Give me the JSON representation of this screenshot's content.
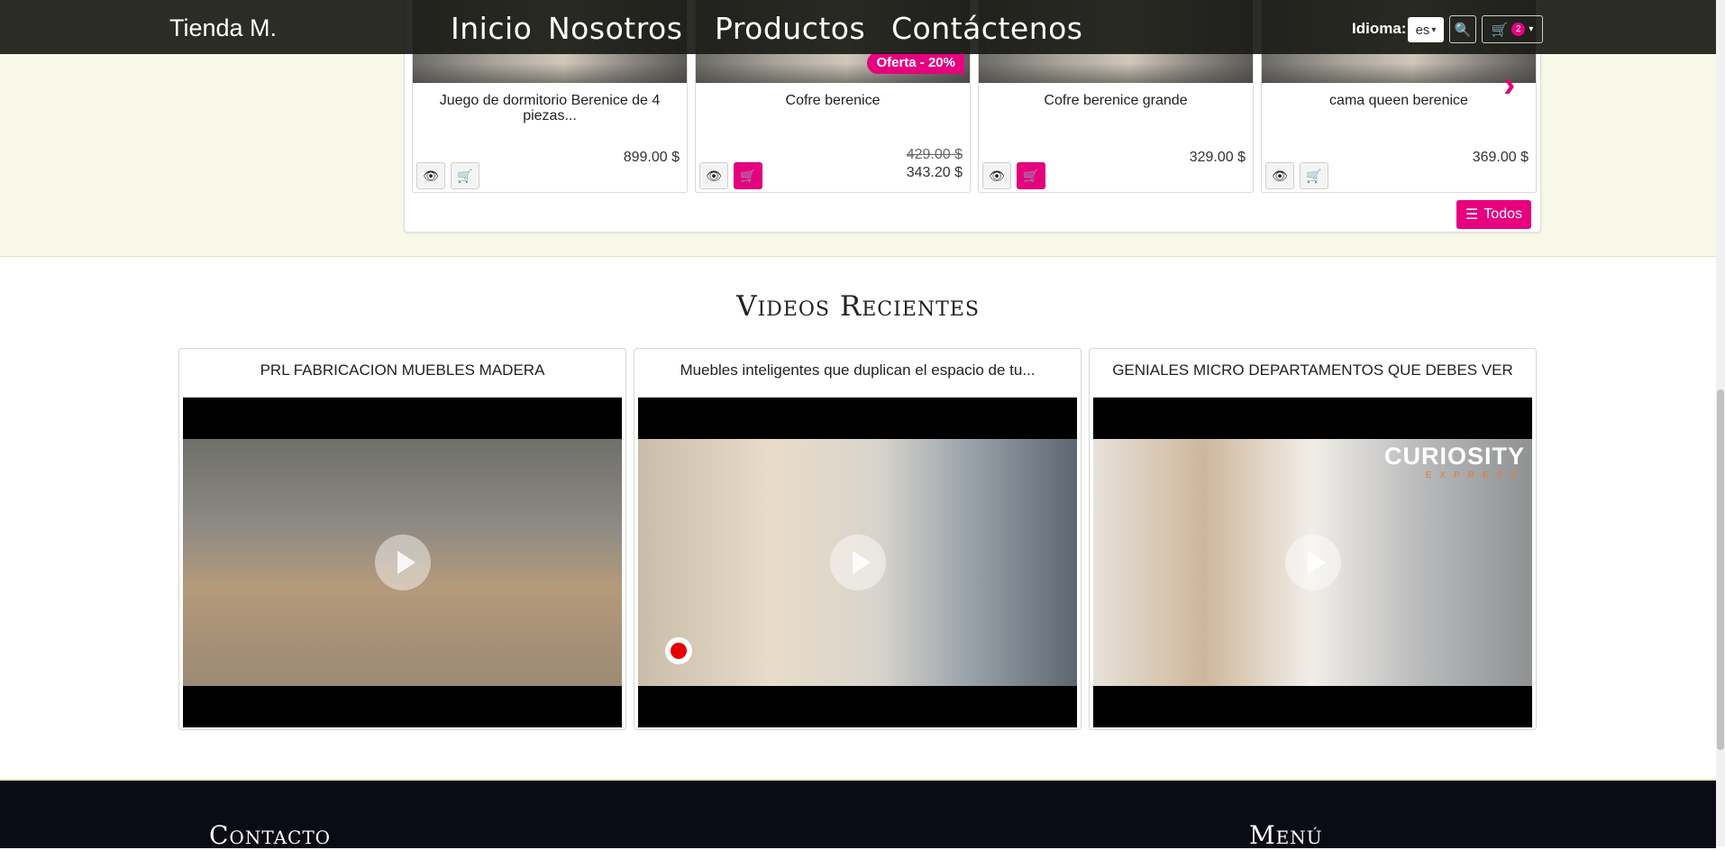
{
  "navbar": {
    "brand": "Tienda M.",
    "links": [
      "Inicio",
      "Nosotros",
      "Productos",
      "Contáctenos"
    ],
    "language_label": "Idioma:",
    "language_value": "es",
    "cart_count": "2"
  },
  "products": {
    "items": [
      {
        "name": "Juego de dormitorio Berenice de 4 piezas...",
        "price": "899.00 $",
        "cart_active": false
      },
      {
        "name": "Cofre berenice",
        "old_price": "429.00 $",
        "price": "343.20 $",
        "badge": "Oferta - 20%",
        "cart_active": true
      },
      {
        "name": "Cofre berenice grande",
        "price": "329.00 $",
        "cart_active": true
      },
      {
        "name": "cama queen berenice",
        "price": "369.00 $",
        "cart_active": false
      }
    ],
    "all_button": "Todos"
  },
  "videos": {
    "title": "Videos Recientes",
    "items": [
      {
        "title": "PRL FABRICACION MUEBLES MADERA"
      },
      {
        "title": "Muebles inteligentes que duplican el espacio de tu..."
      },
      {
        "title": "GENIALES MICRO DEPARTAMENTOS QUE DEBES VER",
        "logo_text": "CURIOSITY",
        "logo_sub": "EXPRESS"
      }
    ]
  },
  "footer": {
    "contact_heading": "Contacto",
    "menu_heading": "Menú"
  },
  "colors": {
    "accent": "#e6007e",
    "navbar": "#1c1c18",
    "band": "#f7f8e8",
    "footer": "#0b0b16"
  }
}
